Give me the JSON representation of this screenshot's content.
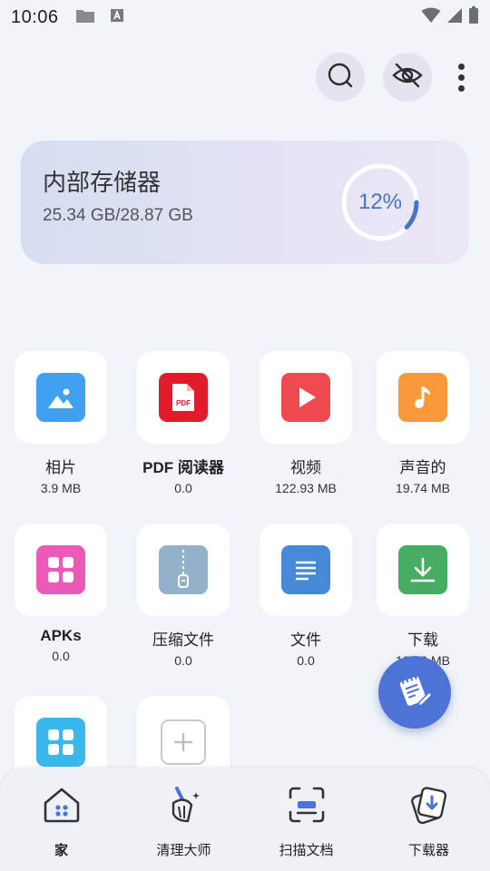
{
  "status_bar": {
    "time": "10:06"
  },
  "storage": {
    "title": "内部存储器",
    "usage": "25.34 GB/28.87 GB",
    "percent_label": "12%",
    "percent_value": 12
  },
  "categories": [
    {
      "label": "相片",
      "size": "3.9 MB",
      "icon": "image-icon",
      "color": "#3fa1f0"
    },
    {
      "label": "PDF 阅读器",
      "size": "0.0",
      "icon": "pdf-icon",
      "color": "#e21b2a"
    },
    {
      "label": "视频",
      "size": "122.93 MB",
      "icon": "play-icon",
      "color": "#ee4a50"
    },
    {
      "label": "声音的",
      "size": "19.74 MB",
      "icon": "music-note-icon",
      "color": "#f8983b"
    },
    {
      "label": "APKs",
      "size": "0.0",
      "icon": "apps-grid-icon",
      "color": "#ea5ab6"
    },
    {
      "label": "压缩文件",
      "size": "0.0",
      "icon": "zip-icon",
      "color": "#93b1c9"
    },
    {
      "label": "文件",
      "size": "0.0",
      "icon": "document-icon",
      "color": "#4689d6"
    },
    {
      "label": "下载",
      "size": "182.3 MB",
      "icon": "download-icon",
      "color": "#47ad62"
    }
  ],
  "extra_tiles": [
    {
      "icon": "apps-grid-icon",
      "color": "#3ab8ec"
    },
    {
      "icon": "add-icon",
      "color": "#c9c9c9"
    }
  ],
  "bottom_nav": [
    {
      "label": "家",
      "icon": "home-icon",
      "active": true
    },
    {
      "label": "清理大师",
      "icon": "broom-icon",
      "active": false
    },
    {
      "label": "扫描文档",
      "icon": "scan-icon",
      "active": false
    },
    {
      "label": "下载器",
      "icon": "downloader-icon",
      "active": false
    }
  ],
  "colors": {
    "accent": "#4d73d7",
    "background": "#f1f4f9"
  }
}
